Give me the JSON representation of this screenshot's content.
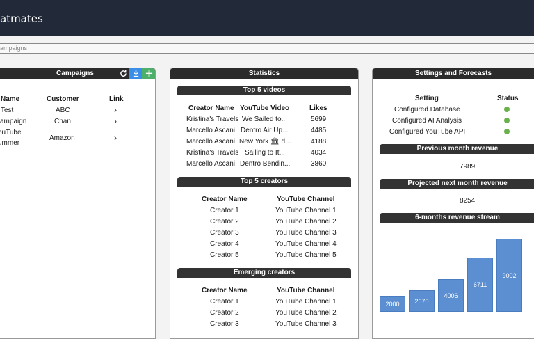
{
  "app": {
    "title": "atmates"
  },
  "breadcrumb": "ampaigns",
  "campaigns": {
    "title": "Campaigns",
    "columns": [
      "Name",
      "Customer",
      "Link"
    ],
    "rows": [
      {
        "name": "Test",
        "customer": "ABC",
        "link": "›"
      },
      {
        "name": " campaign",
        "customer": "Chan",
        "link": "›"
      },
      {
        "name": "ouTube",
        "name2": "ummer",
        "customer": "Amazon",
        "link": "›"
      }
    ]
  },
  "statistics": {
    "title": "Statistics",
    "top_videos": {
      "title": "Top 5 videos",
      "columns": [
        "Creator Name",
        "YouTube Video",
        "Likes"
      ],
      "rows": [
        {
          "creator": "Kristina's Travels",
          "video": "We Sailed to...",
          "likes": "5699"
        },
        {
          "creator": "Marcello Ascani",
          "video": "Dentro Air Up...",
          "likes": "4485"
        },
        {
          "creator": "Marcello Ascani",
          "video": "New York 🏛 d...",
          "likes": "4188"
        },
        {
          "creator": "Kristina's Travels",
          "video": "Sailing to It...",
          "likes": "4034"
        },
        {
          "creator": "Marcello Ascani",
          "video": "Dentro Bendin...",
          "likes": "3860"
        }
      ]
    },
    "top_creators": {
      "title": "Top 5 creators",
      "columns": [
        "Creator Name",
        "YouTube Channel"
      ],
      "rows": [
        {
          "creator": "Creator 1",
          "channel": "YouTube Channel 1"
        },
        {
          "creator": "Creator 2",
          "channel": "YouTube Channel 2"
        },
        {
          "creator": "Creator 3",
          "channel": "YouTube Channel 3"
        },
        {
          "creator": "Creator 4",
          "channel": "YouTube Channel 4"
        },
        {
          "creator": "Creator 5",
          "channel": "YouTube Channel 5"
        }
      ]
    },
    "emerging": {
      "title": "Emerging creators",
      "columns": [
        "Creator Name",
        "YouTube Channel"
      ],
      "rows": [
        {
          "creator": "Creator 1",
          "channel": "YouTube Channel 1"
        },
        {
          "creator": "Creator 2",
          "channel": "YouTube Channel 2"
        },
        {
          "creator": "Creator 3",
          "channel": "YouTube Channel 3"
        }
      ]
    }
  },
  "settings": {
    "title": "Settings and Forecasts",
    "columns": [
      "Setting",
      "Status"
    ],
    "rows": [
      {
        "setting": "Configured Database",
        "status": "ok"
      },
      {
        "setting": "Configured AI Analysis",
        "status": "ok"
      },
      {
        "setting": "Configured YouTube API",
        "status": "ok"
      }
    ],
    "status_color": "#6ab04c",
    "prev_revenue_title": "Previous month revenue",
    "prev_revenue": "7989",
    "projected_title": "Projected next month revenue",
    "projected": "8254",
    "stream_title": "6-months revenue stream"
  },
  "chart_data": {
    "type": "bar",
    "title": "6-months revenue stream",
    "values": [
      2000,
      2670,
      4006,
      6711,
      9002
    ],
    "ylim": [
      0,
      11000
    ],
    "bar_color": "#5b8fd1"
  }
}
